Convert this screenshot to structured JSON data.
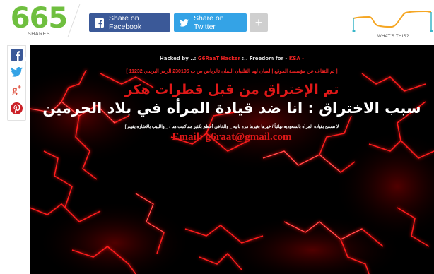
{
  "share": {
    "count": "665",
    "count_label": "SHARES",
    "facebook_label": "Share on Facebook",
    "twitter_label": "Share on Twitter",
    "more_label": "+",
    "whats_this": "WHAT'S THIS?"
  },
  "side_bar": {
    "items": [
      "facebook-icon",
      "twitter-icon",
      "google-plus-icon",
      "pinterest-icon"
    ]
  },
  "hacked_image": {
    "line1_prefix": "Hacked by ..:",
    "line1_name": "G6RaaT Hacker",
    "line1_mid": ":.. Freedom for -",
    "line1_tag": "KSA -",
    "line2": "[ تم التقاف عن مؤسسة الموقع | لمبان لهد القلنيان النمان تالرياض ص ب 230195 الرمز البريدي 11232 ]",
    "line3": "تم الإختراق من قبل قطرات هكر",
    "line4": "سبب الاختراق : انا ضد قيادة المرأه في بلاد الحرمين",
    "line5": "لا نسمح بقيادة المرأه بالسعودية نهائياً / خيرها بغيرها مره ثانية _ والخافي أعظم بكثير مماكتبت هنا / _ والليبب بالاشاره يفهم ]",
    "line6": "Email: g6raat@gmail.com"
  },
  "colors": {
    "share_green": "#6fbf3f",
    "facebook_blue": "#3b5998",
    "twitter_blue": "#34a3e6",
    "hack_red": "#e01818",
    "sparkline_orange": "#f5a623",
    "sparkline_teal": "#38b6c9"
  }
}
